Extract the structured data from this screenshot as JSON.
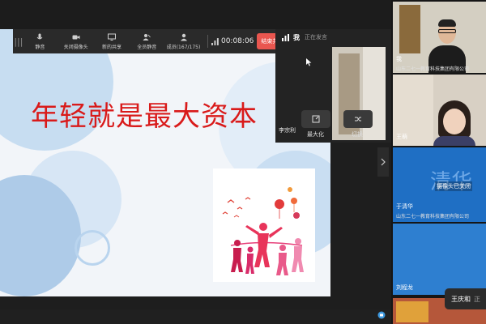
{
  "toolbar": {
    "items": [
      {
        "icon": "mic-icon",
        "label": "静音"
      },
      {
        "icon": "camera-icon",
        "label": "关闭摄像头"
      },
      {
        "icon": "share-screen-icon",
        "label": "新的共享"
      },
      {
        "icon": "mute-all-icon",
        "label": "全员静音"
      },
      {
        "icon": "members-icon",
        "label": "成员(167/175)"
      }
    ],
    "timer": "00:08:06",
    "end_share_label": "结束共享"
  },
  "slide": {
    "title": "年轻就是最大资本"
  },
  "speaker_panel": {
    "name": "我",
    "status": "正在发言",
    "member_name": "李宗利",
    "maximize_label": "最大化",
    "switch_label": "切换"
  },
  "gallery": {
    "tiles": [
      {
        "name": "我",
        "org": "山东二七一教育科技集团有限公司"
      },
      {
        "name": "王萌",
        "org": ""
      },
      {
        "name": "于清华",
        "org": "山东二七一教育科技集团有限公司",
        "bg_text": "清华",
        "camera_off": "摄像头已关闭"
      },
      {
        "name": "刘程龙",
        "org": ""
      }
    ]
  },
  "popup": {
    "name": "王庆和",
    "extra": "正"
  },
  "colors": {
    "accent_red": "#e9564f",
    "title_red": "#d91a1a",
    "tile_blue": "#1f6fc4"
  }
}
